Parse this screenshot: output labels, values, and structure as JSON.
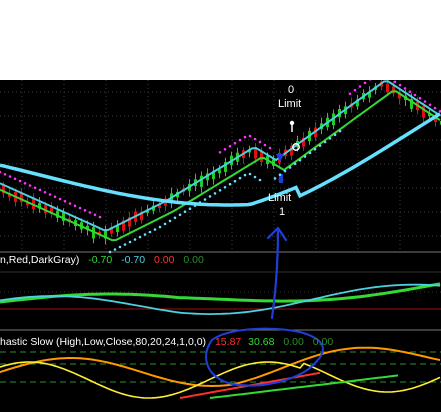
{
  "annotations": {
    "top_order": {
      "count": "0",
      "text": "Limit"
    },
    "bottom_order": {
      "count": "1",
      "text": "Limit"
    }
  },
  "indicator_1": {
    "label": "n,Red,DarkGray)",
    "values": [
      "-0.70",
      "-0.70",
      "0.00",
      "0.00"
    ],
    "colors": [
      "#35d935",
      "#4dd0e1",
      "#ff3030",
      "#2e8b2e"
    ]
  },
  "indicator_2": {
    "label": "hastic Slow (High,Low,Close,80,20,24,1,0,0)",
    "values": [
      "15.87",
      "30.68",
      "0.00",
      "0.00"
    ],
    "colors": [
      "#ff3030",
      "#35d935",
      "#2e8b2e",
      "#2e8b2e"
    ]
  },
  "colors": {
    "background": "#000000",
    "up_bar": "#22cc22",
    "down_bar": "#dd1111",
    "fast_ma": "#4dd0e1",
    "slow_ma": "#35d935",
    "baseline": "#66e0ff",
    "parabolic": "#ff33ff",
    "annotation": "#1f3fd6"
  }
}
